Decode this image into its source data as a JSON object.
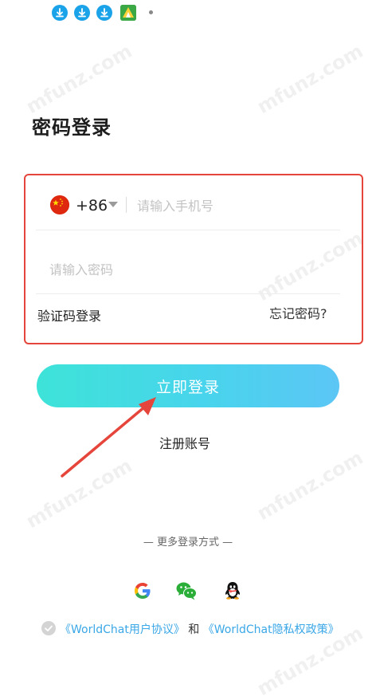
{
  "status_bar": {
    "icons": [
      "download-icon",
      "download-icon",
      "download-icon",
      "app-notification-icon",
      "more-dot-icon"
    ]
  },
  "watermark": "mfunz.com",
  "page_title": "密码登录",
  "form": {
    "country_code": "+86",
    "phone_placeholder": "请输入手机号",
    "password_placeholder": "请输入密码",
    "sms_login_label": "验证码登录",
    "forgot_password_label": "忘记密码?"
  },
  "login_button_label": "立即登录",
  "register_label": "注册账号",
  "more_login_label": "— 更多登录方式 —",
  "social_logins": [
    "google-icon",
    "wechat-icon",
    "qq-icon"
  ],
  "agreement": {
    "user_agreement": "《WorldChat用户协议》",
    "and": "和",
    "privacy_policy": "《WorldChat隐私权政策》"
  },
  "colors": {
    "accent_gradient_start": "#3ee3d8",
    "accent_gradient_end": "#5cc6f5",
    "annotation_red": "#e5453a",
    "link_blue": "#3aa7e6"
  }
}
